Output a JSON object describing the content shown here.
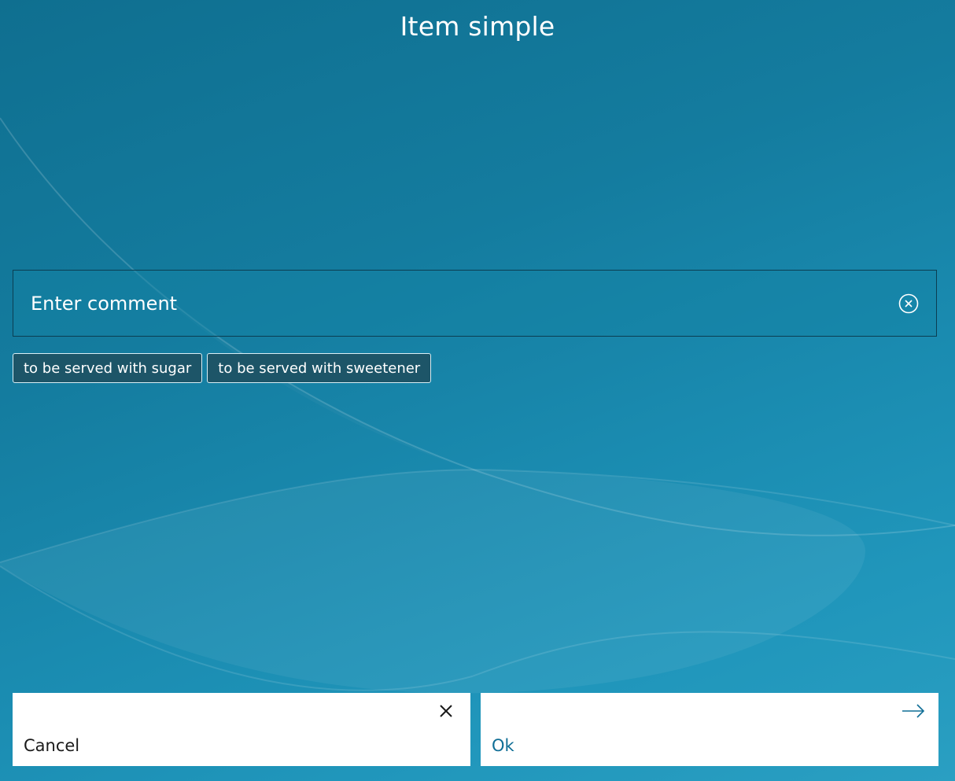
{
  "header": {
    "title": "Item simple"
  },
  "comment": {
    "placeholder": "Enter comment",
    "value": "",
    "clear_icon": "clear-circle-x-icon"
  },
  "suggestions": [
    {
      "label": "to be served with sugar"
    },
    {
      "label": "to be served with sweetener"
    }
  ],
  "actions": {
    "cancel": {
      "label": "Cancel",
      "icon": "close-icon"
    },
    "ok": {
      "label": "Ok",
      "icon": "arrow-right-icon"
    }
  },
  "colors": {
    "background": "#147c9f",
    "chip_background": "#1d5568",
    "ok_text": "#0f6e96",
    "cancel_text": "#1a1a1a"
  }
}
